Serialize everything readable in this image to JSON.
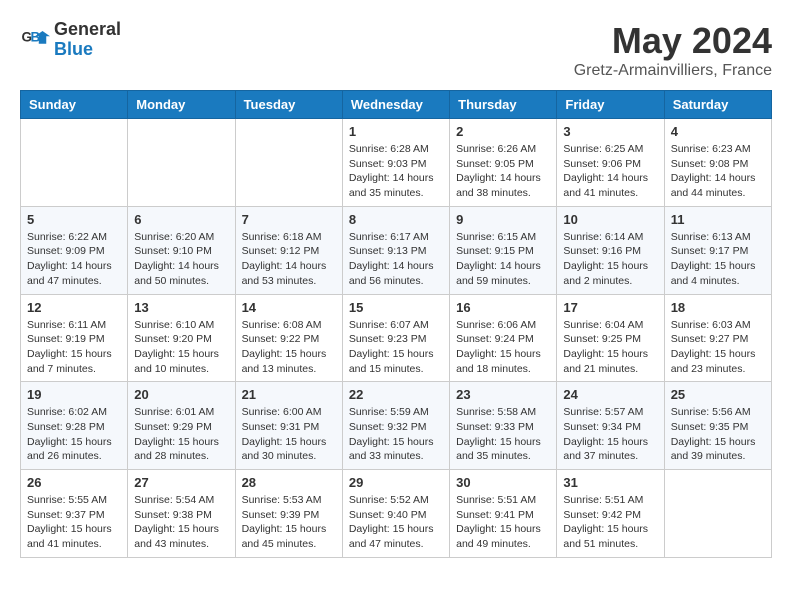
{
  "header": {
    "logo_line1": "General",
    "logo_line2": "Blue",
    "month_title": "May 2024",
    "location": "Gretz-Armainvilliers, France"
  },
  "days_of_week": [
    "Sunday",
    "Monday",
    "Tuesday",
    "Wednesday",
    "Thursday",
    "Friday",
    "Saturday"
  ],
  "weeks": [
    [
      {
        "day": "",
        "info": ""
      },
      {
        "day": "",
        "info": ""
      },
      {
        "day": "",
        "info": ""
      },
      {
        "day": "1",
        "info": "Sunrise: 6:28 AM\nSunset: 9:03 PM\nDaylight: 14 hours\nand 35 minutes."
      },
      {
        "day": "2",
        "info": "Sunrise: 6:26 AM\nSunset: 9:05 PM\nDaylight: 14 hours\nand 38 minutes."
      },
      {
        "day": "3",
        "info": "Sunrise: 6:25 AM\nSunset: 9:06 PM\nDaylight: 14 hours\nand 41 minutes."
      },
      {
        "day": "4",
        "info": "Sunrise: 6:23 AM\nSunset: 9:08 PM\nDaylight: 14 hours\nand 44 minutes."
      }
    ],
    [
      {
        "day": "5",
        "info": "Sunrise: 6:22 AM\nSunset: 9:09 PM\nDaylight: 14 hours\nand 47 minutes."
      },
      {
        "day": "6",
        "info": "Sunrise: 6:20 AM\nSunset: 9:10 PM\nDaylight: 14 hours\nand 50 minutes."
      },
      {
        "day": "7",
        "info": "Sunrise: 6:18 AM\nSunset: 9:12 PM\nDaylight: 14 hours\nand 53 minutes."
      },
      {
        "day": "8",
        "info": "Sunrise: 6:17 AM\nSunset: 9:13 PM\nDaylight: 14 hours\nand 56 minutes."
      },
      {
        "day": "9",
        "info": "Sunrise: 6:15 AM\nSunset: 9:15 PM\nDaylight: 14 hours\nand 59 minutes."
      },
      {
        "day": "10",
        "info": "Sunrise: 6:14 AM\nSunset: 9:16 PM\nDaylight: 15 hours\nand 2 minutes."
      },
      {
        "day": "11",
        "info": "Sunrise: 6:13 AM\nSunset: 9:17 PM\nDaylight: 15 hours\nand 4 minutes."
      }
    ],
    [
      {
        "day": "12",
        "info": "Sunrise: 6:11 AM\nSunset: 9:19 PM\nDaylight: 15 hours\nand 7 minutes."
      },
      {
        "day": "13",
        "info": "Sunrise: 6:10 AM\nSunset: 9:20 PM\nDaylight: 15 hours\nand 10 minutes."
      },
      {
        "day": "14",
        "info": "Sunrise: 6:08 AM\nSunset: 9:22 PM\nDaylight: 15 hours\nand 13 minutes."
      },
      {
        "day": "15",
        "info": "Sunrise: 6:07 AM\nSunset: 9:23 PM\nDaylight: 15 hours\nand 15 minutes."
      },
      {
        "day": "16",
        "info": "Sunrise: 6:06 AM\nSunset: 9:24 PM\nDaylight: 15 hours\nand 18 minutes."
      },
      {
        "day": "17",
        "info": "Sunrise: 6:04 AM\nSunset: 9:25 PM\nDaylight: 15 hours\nand 21 minutes."
      },
      {
        "day": "18",
        "info": "Sunrise: 6:03 AM\nSunset: 9:27 PM\nDaylight: 15 hours\nand 23 minutes."
      }
    ],
    [
      {
        "day": "19",
        "info": "Sunrise: 6:02 AM\nSunset: 9:28 PM\nDaylight: 15 hours\nand 26 minutes."
      },
      {
        "day": "20",
        "info": "Sunrise: 6:01 AM\nSunset: 9:29 PM\nDaylight: 15 hours\nand 28 minutes."
      },
      {
        "day": "21",
        "info": "Sunrise: 6:00 AM\nSunset: 9:31 PM\nDaylight: 15 hours\nand 30 minutes."
      },
      {
        "day": "22",
        "info": "Sunrise: 5:59 AM\nSunset: 9:32 PM\nDaylight: 15 hours\nand 33 minutes."
      },
      {
        "day": "23",
        "info": "Sunrise: 5:58 AM\nSunset: 9:33 PM\nDaylight: 15 hours\nand 35 minutes."
      },
      {
        "day": "24",
        "info": "Sunrise: 5:57 AM\nSunset: 9:34 PM\nDaylight: 15 hours\nand 37 minutes."
      },
      {
        "day": "25",
        "info": "Sunrise: 5:56 AM\nSunset: 9:35 PM\nDaylight: 15 hours\nand 39 minutes."
      }
    ],
    [
      {
        "day": "26",
        "info": "Sunrise: 5:55 AM\nSunset: 9:37 PM\nDaylight: 15 hours\nand 41 minutes."
      },
      {
        "day": "27",
        "info": "Sunrise: 5:54 AM\nSunset: 9:38 PM\nDaylight: 15 hours\nand 43 minutes."
      },
      {
        "day": "28",
        "info": "Sunrise: 5:53 AM\nSunset: 9:39 PM\nDaylight: 15 hours\nand 45 minutes."
      },
      {
        "day": "29",
        "info": "Sunrise: 5:52 AM\nSunset: 9:40 PM\nDaylight: 15 hours\nand 47 minutes."
      },
      {
        "day": "30",
        "info": "Sunrise: 5:51 AM\nSunset: 9:41 PM\nDaylight: 15 hours\nand 49 minutes."
      },
      {
        "day": "31",
        "info": "Sunrise: 5:51 AM\nSunset: 9:42 PM\nDaylight: 15 hours\nand 51 minutes."
      },
      {
        "day": "",
        "info": ""
      }
    ]
  ]
}
